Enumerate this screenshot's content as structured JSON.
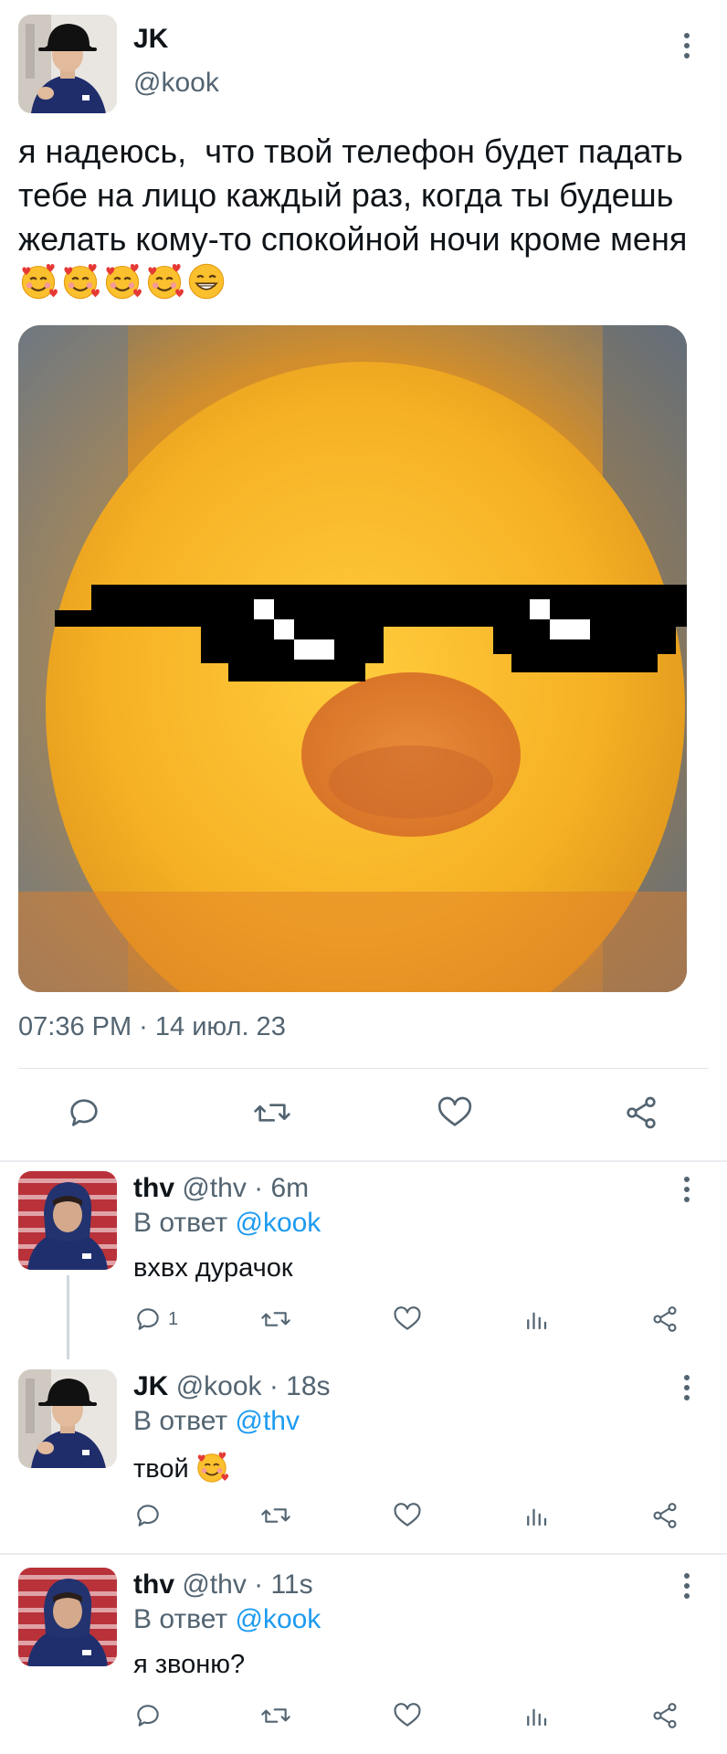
{
  "tweet": {
    "name": "JK",
    "handle": "@kook",
    "text": "я надеюсь,  что твой телефон будет падать тебе на лицо каждый раз, когда ты будешь желать кому-то спокойной ночи кроме меня",
    "emojis": [
      "smiling-face-with-hearts",
      "smiling-face-with-hearts",
      "smiling-face-with-hearts",
      "smiling-face-with-hearts",
      "grinning-face-with-smiling-eyes"
    ],
    "timestamp": "07:36 PM · 14 июл. 23",
    "actions": [
      "reply-icon",
      "retweet-icon",
      "like-icon",
      "share-icon"
    ]
  },
  "replies": [
    {
      "name": "thv",
      "meta": "@thv · 6m",
      "reply_prefix": "В ответ ",
      "reply_to": "@kook",
      "text": "вхвх дурачок",
      "reply_count": "1",
      "emoji": ""
    },
    {
      "name": "JK",
      "meta": "@kook · 18s",
      "reply_prefix": "В ответ ",
      "reply_to": "@thv",
      "text": "твой",
      "reply_count": "",
      "emoji": "smiling-face-with-hearts"
    },
    {
      "name": "thv",
      "meta": "@thv · 11s",
      "reply_prefix": "В ответ ",
      "reply_to": "@kook",
      "text": "я звоню?",
      "reply_count": "",
      "emoji": ""
    }
  ],
  "colors": {
    "text": "#0f1419",
    "secondary": "#536471",
    "mention": "#1d9bf0",
    "divider": "#e9ecef"
  }
}
